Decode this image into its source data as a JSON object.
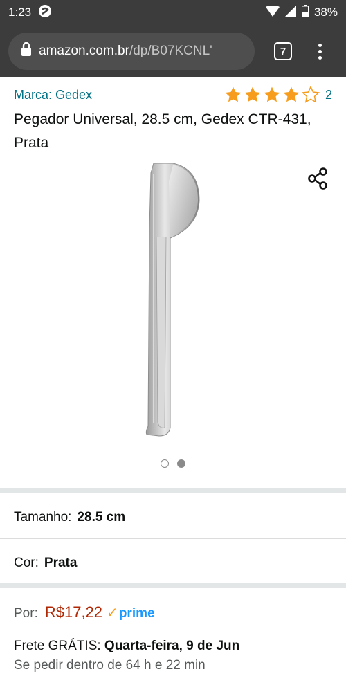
{
  "status": {
    "time": "1:23",
    "battery": "38%"
  },
  "browser": {
    "url_host": "amazon.com.br",
    "url_path": "/dp/B07KCNL'",
    "tab_count": "7"
  },
  "product": {
    "brand": "Marca: Gedex",
    "rating": 4,
    "rating_count": "2",
    "title": "Pegador Universal, 28.5 cm, Gedex CTR-431, Prata",
    "image_total": 2,
    "image_active": 2
  },
  "options": {
    "size_label": "Tamanho:",
    "size_value": "28.5 cm",
    "color_label": "Cor:",
    "color_value": "Prata"
  },
  "price": {
    "label": "Por:",
    "value": "R$17,22",
    "prime": "prime"
  },
  "delivery": {
    "prefix": "Frete GRÁTIS:",
    "date": "Quarta-feira, 9 de Jun",
    "cutoff": "Se pedir dentro de 64 h e 22 min"
  },
  "icons": [
    "wifi-icon",
    "signal-icon",
    "battery-icon",
    "lock-icon",
    "share-icon",
    "star-icon",
    "prime-check-icon"
  ],
  "colors": {
    "link": "#007185",
    "price": "#B12704",
    "star": "#f79d1e",
    "prime": "#1a98ff",
    "chrome_bg": "#3c3c3c"
  }
}
